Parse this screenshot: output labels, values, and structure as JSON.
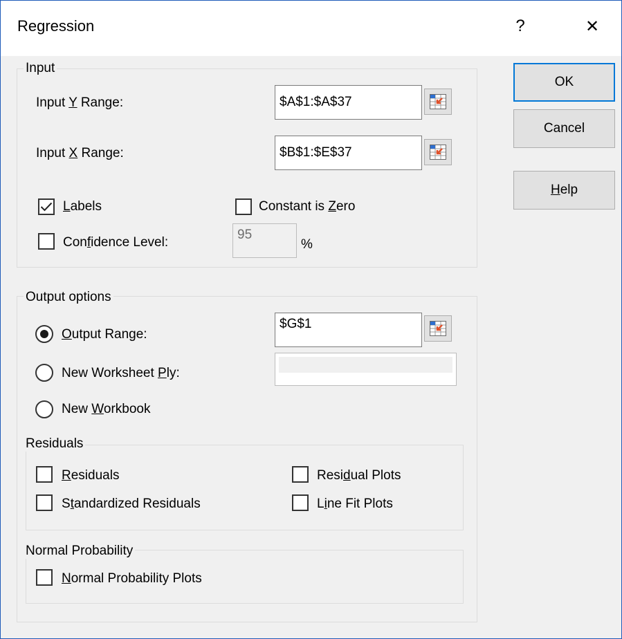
{
  "window": {
    "title": "Regression",
    "help_glyph": "?",
    "close_glyph": "✕"
  },
  "buttons": {
    "ok": "OK",
    "cancel": "Cancel",
    "help": {
      "pre": "",
      "u": "H",
      "post": "elp"
    }
  },
  "input": {
    "legend": "Input",
    "y_range": {
      "label": {
        "pre": "Input ",
        "u": "Y",
        "post": " Range:"
      },
      "value": "$A$1:$A$37"
    },
    "x_range": {
      "label": {
        "pre": "Input ",
        "u": "X",
        "post": " Range:"
      },
      "value": "$B$1:$E$37"
    },
    "labels": {
      "label": {
        "pre": "",
        "u": "L",
        "post": "abels"
      },
      "checked": true
    },
    "constant_zero": {
      "label": {
        "pre": "Constant is ",
        "u": "Z",
        "post": "ero"
      },
      "checked": false
    },
    "confidence": {
      "label": {
        "pre": "Con",
        "u": "f",
        "post": "idence Level:"
      },
      "checked": false,
      "value": "95",
      "unit": "%"
    }
  },
  "output": {
    "legend": "Output options",
    "output_range": {
      "label": {
        "pre": "",
        "u": "O",
        "post": "utput Range:"
      },
      "selected": true,
      "value": "$G$1"
    },
    "new_ply": {
      "label": {
        "pre": "New Worksheet ",
        "u": "P",
        "post": "ly:"
      },
      "selected": false,
      "value": ""
    },
    "new_workbook": {
      "label": {
        "pre": "New ",
        "u": "W",
        "post": "orkbook"
      },
      "selected": false
    }
  },
  "residuals": {
    "legend": "Residuals",
    "residuals": {
      "label": {
        "pre": "",
        "u": "R",
        "post": "esiduals"
      },
      "checked": false
    },
    "standardized": {
      "label": {
        "pre": "S",
        "u": "t",
        "post": "andardized Residuals"
      },
      "checked": false
    },
    "residual_plots": {
      "label": {
        "pre": "Resi",
        "u": "d",
        "post": "ual Plots"
      },
      "checked": false
    },
    "line_fit": {
      "label": {
        "pre": "L",
        "u": "i",
        "post": "ne Fit Plots"
      },
      "checked": false
    }
  },
  "normal_probability": {
    "legend": "Normal Probability",
    "plots": {
      "label": {
        "pre": "",
        "u": "N",
        "post": "ormal Probability Plots"
      },
      "checked": false
    }
  },
  "colors": {
    "accent": "#0078d7",
    "border": "#1e5bb8",
    "dialog_bg": "#f0f0f0"
  },
  "icons": {
    "range_selector": "collapse-dialog-icon"
  }
}
